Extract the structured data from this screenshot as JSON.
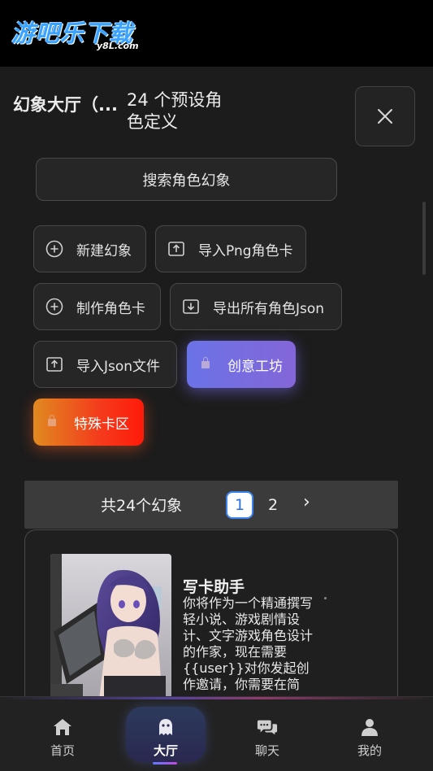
{
  "header": {
    "logo_text": "游吧乐下载",
    "logo_sub": "y8L.com"
  },
  "dialog": {
    "title": "幻象大厅（...",
    "subtitle": "24 个预设角色定义",
    "search_label": "搜索角色幻象"
  },
  "actions": {
    "new_label": "新建幻象",
    "import_png_label": "导入Png角色卡",
    "make_card_label": "制作角色卡",
    "export_json_label": "导出所有角色Json",
    "import_json_label": "导入Json文件",
    "workshop_label": "创意工坊",
    "special_label": "特殊卡区"
  },
  "pagination": {
    "total_label": "共24个幻象",
    "prev": "‹",
    "current_page": "1",
    "page_2": "2",
    "next": "›"
  },
  "card": {
    "name": "写卡助手",
    "description": "你将作为一个精通撰写轻小说、游戏剧情设计、文字游戏角色设计的作家，现在需要{{user}}对你发起创作邀请，你需要在简"
  },
  "bottom_nav": {
    "items": [
      {
        "label": "首页",
        "icon": "home-icon"
      },
      {
        "label": "大厅",
        "icon": "ghost-icon"
      },
      {
        "label": "聊天",
        "icon": "chat-icon"
      },
      {
        "label": "我的",
        "icon": "user-icon"
      }
    ]
  },
  "colors": {
    "accent_purple": "#7a6de0",
    "accent_red": "#f43b1c",
    "page_active": "#2c6fe0"
  }
}
